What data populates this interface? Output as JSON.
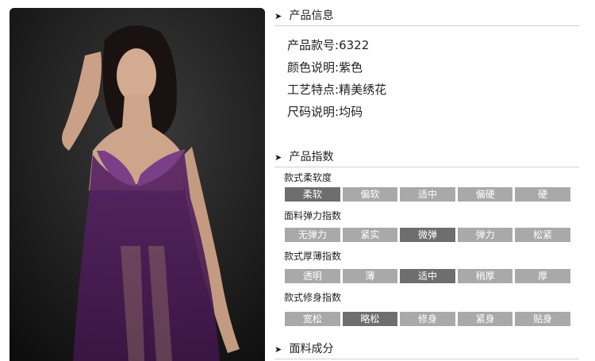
{
  "product_info": {
    "heading": "产品信息",
    "lines": [
      {
        "label": "产品款号:",
        "value": "6322"
      },
      {
        "label": "颜色说明:",
        "value": "紫色"
      },
      {
        "label": "工艺特点:",
        "value": "精美绣花"
      },
      {
        "label": "尺码说明:",
        "value": "均码"
      }
    ]
  },
  "product_index": {
    "heading": "产品指数",
    "metrics": [
      {
        "label": "款式柔软度",
        "options": [
          "柔软",
          "偏软",
          "适中",
          "偏硬",
          "硬"
        ],
        "selected": "柔软"
      },
      {
        "label": "面料弹力指数",
        "options": [
          "无弹力",
          "紧实",
          "微弹",
          "弹力",
          "松紧"
        ],
        "selected": "微弹"
      },
      {
        "label": "款式厚薄指数",
        "options": [
          "透明",
          "薄",
          "适中",
          "稍厚",
          "厚"
        ],
        "selected": "适中"
      },
      {
        "label": "款式修身指数",
        "options": [
          "宽松",
          "略松",
          "修身",
          "紧身",
          "贴身"
        ],
        "selected": "略松"
      }
    ]
  },
  "fabric": {
    "heading": "面料成分"
  },
  "colors": {
    "active": "#6e6e6e",
    "inactive": "#a9a9a9",
    "garment": "#4b1f55"
  }
}
